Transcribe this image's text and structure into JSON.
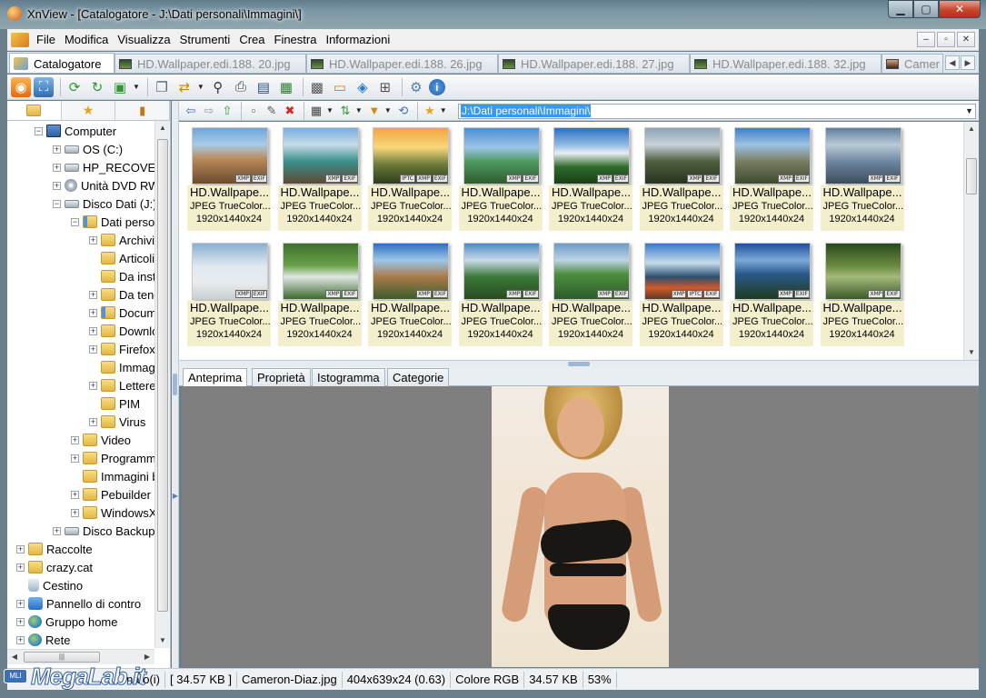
{
  "window": {
    "title": "XnView - [Catalogatore - J:\\Dati personali\\Immagini\\]",
    "minimize": "▁",
    "maximize": "▢",
    "close": "✕"
  },
  "menu": [
    "File",
    "Modifica",
    "Visualizza",
    "Strumenti",
    "Crea",
    "Finestra",
    "Informazioni"
  ],
  "mdi_buttons": [
    "–",
    "▫",
    "✕"
  ],
  "doc_tabs": [
    {
      "label": "Catalogatore",
      "active": true
    },
    {
      "label": "HD.Wallpaper.edi.188. 20.jpg",
      "active": false
    },
    {
      "label": "HD.Wallpaper.edi.188. 26.jpg",
      "active": false
    },
    {
      "label": "HD.Wallpaper.edi.188. 27.jpg",
      "active": false
    },
    {
      "label": "HD.Wallpaper.edi.188. 32.jpg",
      "active": false
    },
    {
      "label": "Camer",
      "active": false
    }
  ],
  "address": {
    "path": "J:\\Dati personali\\Immagini\\"
  },
  "tree": [
    {
      "label": "Computer",
      "icon": "computer-icon",
      "exp": "−"
    },
    {
      "label": "OS (C:)",
      "icon": "drive-icon",
      "exp": "+"
    },
    {
      "label": "HP_RECOVERY",
      "icon": "drive-icon",
      "exp": "+"
    },
    {
      "label": "Unità DVD RW",
      "icon": "dvd-icon",
      "exp": "+"
    },
    {
      "label": "Disco Dati (J:)",
      "icon": "drive-icon",
      "exp": "−"
    },
    {
      "label": "Dati person",
      "icon": "folder-docs-icon",
      "exp": "−"
    },
    {
      "label": "Archivio",
      "icon": "folder-icon",
      "exp": "+"
    },
    {
      "label": "Articoli",
      "icon": "folder-icon",
      "exp": ""
    },
    {
      "label": "Da insta",
      "icon": "folder-icon",
      "exp": ""
    },
    {
      "label": "Da tene",
      "icon": "folder-icon",
      "exp": "+"
    },
    {
      "label": "Docume",
      "icon": "folder-docs-icon",
      "exp": "+"
    },
    {
      "label": "Downlo",
      "icon": "folder-icon",
      "exp": "+"
    },
    {
      "label": "Firefox",
      "icon": "folder-icon",
      "exp": "+"
    },
    {
      "label": "Immagi",
      "icon": "folder-icon",
      "exp": ""
    },
    {
      "label": "Lettere",
      "icon": "folder-icon",
      "exp": "+"
    },
    {
      "label": "PIM",
      "icon": "folder-icon",
      "exp": ""
    },
    {
      "label": "Virus",
      "icon": "folder-icon",
      "exp": "+"
    },
    {
      "label": "Video",
      "icon": "folder-icon",
      "exp": "+"
    },
    {
      "label": "Programmi",
      "icon": "folder-icon",
      "exp": "+"
    },
    {
      "label": "Immagini b",
      "icon": "folder-icon",
      "exp": ""
    },
    {
      "label": "Pebuilder",
      "icon": "folder-icon",
      "exp": "+"
    },
    {
      "label": "WindowsXp",
      "icon": "folder-icon",
      "exp": "+"
    },
    {
      "label": "Disco Backup (",
      "icon": "drive-icon",
      "exp": "+"
    },
    {
      "label": "Raccolte",
      "icon": "folder-icon",
      "exp": "+"
    },
    {
      "label": "crazy.cat",
      "icon": "folder-icon",
      "exp": "+"
    },
    {
      "label": "Cestino",
      "icon": "recycle-bin-icon",
      "exp": ""
    },
    {
      "label": "Pannello di contro",
      "icon": "control-panel-icon",
      "exp": "+"
    },
    {
      "label": "Gruppo home",
      "icon": "homegroup-icon",
      "exp": "+"
    },
    {
      "label": "Rete",
      "icon": "network-icon",
      "exp": "+"
    }
  ],
  "thumbnails": [
    {
      "name": "HD.Wallpape...",
      "type": "JPEG TrueColor...",
      "dims": "1920x1440x24",
      "badges": [
        "XMP",
        "EXIF"
      ]
    },
    {
      "name": "HD.Wallpape...",
      "type": "JPEG TrueColor...",
      "dims": "1920x1440x24",
      "badges": [
        "XMP",
        "EXIF"
      ]
    },
    {
      "name": "HD.Wallpape...",
      "type": "JPEG TrueColor...",
      "dims": "1920x1440x24",
      "badges": [
        "IPTC",
        "XMP",
        "EXIF"
      ]
    },
    {
      "name": "HD.Wallpape...",
      "type": "JPEG TrueColor...",
      "dims": "1920x1440x24",
      "badges": [
        "XMP",
        "EXIF"
      ]
    },
    {
      "name": "HD.Wallpape...",
      "type": "JPEG TrueColor...",
      "dims": "1920x1440x24",
      "badges": [
        "XMP",
        "EXIF"
      ]
    },
    {
      "name": "HD.Wallpape...",
      "type": "JPEG TrueColor...",
      "dims": "1920x1440x24",
      "badges": [
        "XMP",
        "EXIF"
      ]
    },
    {
      "name": "HD.Wallpape...",
      "type": "JPEG TrueColor...",
      "dims": "1920x1440x24",
      "badges": [
        "XMP",
        "EXIF"
      ]
    },
    {
      "name": "HD.Wallpape...",
      "type": "JPEG TrueColor...",
      "dims": "1920x1440x24",
      "badges": [
        "XMP",
        "EXIF"
      ]
    },
    {
      "name": "HD.Wallpape...",
      "type": "JPEG TrueColor...",
      "dims": "1920x1440x24",
      "badges": [
        "XMP",
        "EXIF"
      ]
    },
    {
      "name": "HD.Wallpape...",
      "type": "JPEG TrueColor...",
      "dims": "1920x1440x24",
      "badges": [
        "XMP",
        "EXIF"
      ]
    },
    {
      "name": "HD.Wallpape...",
      "type": "JPEG TrueColor...",
      "dims": "1920x1440x24",
      "badges": [
        "XMP",
        "EXIF"
      ]
    },
    {
      "name": "HD.Wallpape...",
      "type": "JPEG TrueColor...",
      "dims": "1920x1440x24",
      "badges": [
        "XMP",
        "EXIF"
      ]
    },
    {
      "name": "HD.Wallpape...",
      "type": "JPEG TrueColor...",
      "dims": "1920x1440x24",
      "badges": [
        "XMP",
        "EXIF"
      ]
    },
    {
      "name": "HD.Wallpape...",
      "type": "JPEG TrueColor...",
      "dims": "1920x1440x24",
      "badges": [
        "XMP",
        "IPTC",
        "EXIF"
      ]
    },
    {
      "name": "HD.Wallpape...",
      "type": "JPEG TrueColor...",
      "dims": "1920x1440x24",
      "badges": [
        "XMP",
        "EXIF"
      ]
    },
    {
      "name": "HD.Wallpape...",
      "type": "JPEG TrueColor...",
      "dims": "1920x1440x24",
      "badges": [
        "XMP",
        "EXIF"
      ]
    }
  ],
  "preview_tabs": [
    "Anteprima",
    "Proprietà",
    "Istogramma",
    "Categorie"
  ],
  "status": [
    "nato(i)",
    "[ 34.57 KB ]",
    "Cameron-Diaz.jpg",
    "404x639x24 (0.63)",
    "Colore RGB",
    "34.57 KB",
    "53%"
  ],
  "watermark": {
    "text": "MegaLab.it",
    "badge": "MLI"
  },
  "colors": {
    "selection": "#3399ff",
    "thumb_caption_bg": "#f3efcd",
    "preview_bg": "#7f7f7f"
  }
}
